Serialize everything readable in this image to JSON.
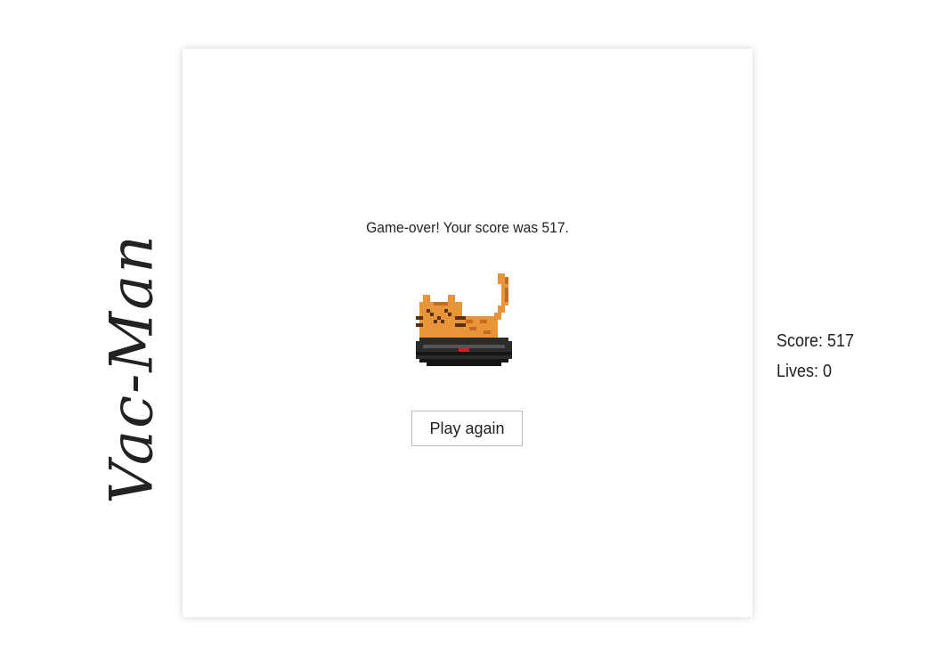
{
  "title": "Vac-Man",
  "game_over": {
    "message": "Game-over! Your score was 517.",
    "play_again_label": "Play again"
  },
  "sprite": {
    "icon": "cat-on-robot-vacuum-icon",
    "colors": {
      "cat_fur": "#e8953a",
      "cat_dark": "#c86a1e",
      "cat_outline": "#5a3010",
      "vacuum_body": "#2b2b2b",
      "vacuum_dark": "#151515",
      "vacuum_light": "#555555",
      "vacuum_led": "#d62020"
    }
  },
  "stats": {
    "score_text": "Score: 517",
    "lives_text": "Lives: 0"
  }
}
